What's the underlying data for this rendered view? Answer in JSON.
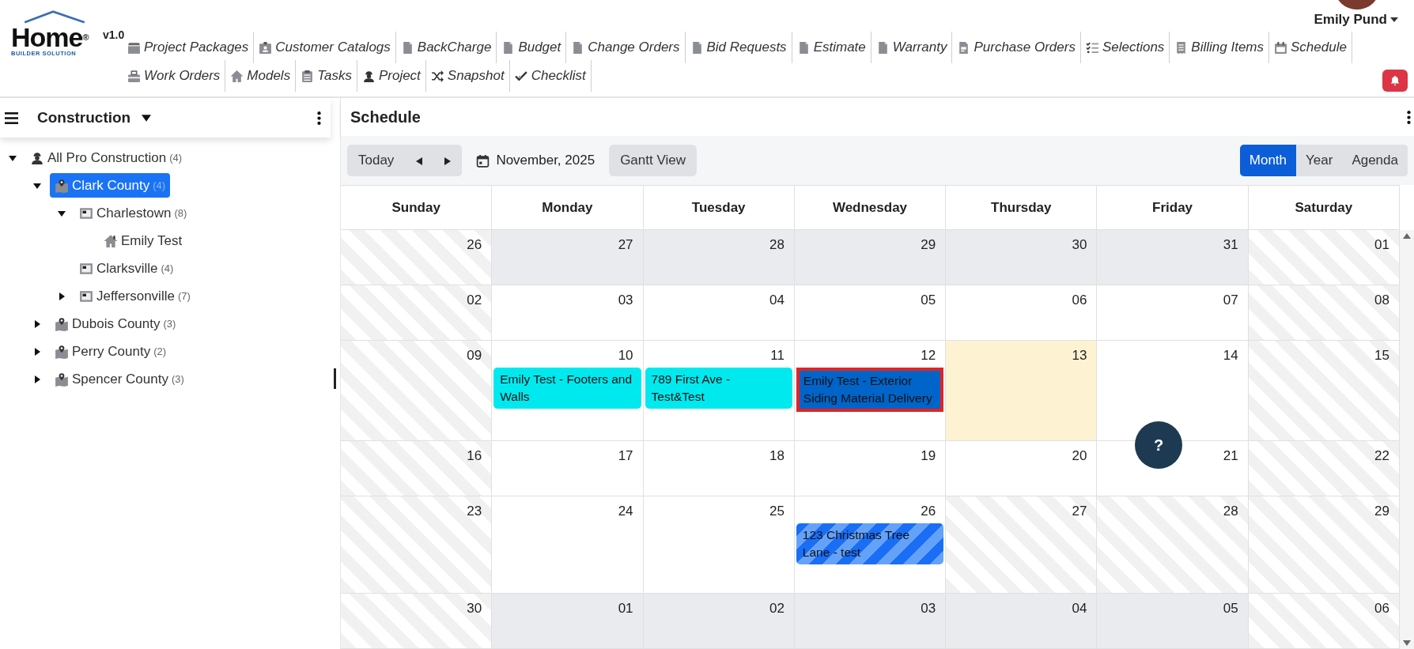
{
  "logo": {
    "name": "Home",
    "mark": "®",
    "tagline": "BUILDER SOLUTION",
    "version": "v1.0"
  },
  "nav_rows": [
    [
      {
        "label": "Project Packages",
        "kind": "package"
      },
      {
        "label": "Customer Catalogs",
        "kind": "badge"
      },
      {
        "label": "BackCharge",
        "kind": "document"
      },
      {
        "label": "Budget",
        "kind": "document"
      },
      {
        "label": "Change Orders",
        "kind": "document"
      },
      {
        "label": "Bid Requests",
        "kind": "document"
      },
      {
        "label": "Estimate",
        "kind": "document"
      },
      {
        "label": "Warranty",
        "kind": "document"
      },
      {
        "label": "Purchase Orders",
        "kind": "invoice"
      },
      {
        "label": "Selections",
        "kind": "checklist"
      },
      {
        "label": "Billing Items",
        "kind": "receipt"
      },
      {
        "label": "Schedule",
        "kind": "calendar"
      }
    ],
    [
      {
        "label": "Work Orders",
        "kind": "toolbox"
      },
      {
        "label": "Models",
        "kind": "house"
      },
      {
        "label": "Tasks",
        "kind": "clipboard"
      },
      {
        "label": "Project",
        "kind": "worker"
      },
      {
        "label": "Snapshot",
        "kind": "shuffle"
      },
      {
        "label": "Checklist",
        "kind": "check"
      }
    ]
  ],
  "user": {
    "name": "Emily Pund"
  },
  "sidebar": {
    "title": "Construction",
    "tree": [
      {
        "label": "All Pro Construction",
        "count": "(4)",
        "kind": "company",
        "expanded": true,
        "selected": false,
        "children": [
          {
            "label": "Clark County",
            "count": "(4)",
            "kind": "county",
            "expanded": true,
            "selected": true,
            "children": [
              {
                "label": "Charlestown",
                "count": "(8)",
                "kind": "city",
                "expanded": true,
                "selected": false,
                "children": [
                  {
                    "label": "Emily Test",
                    "kind": "home",
                    "selected": false
                  }
                ]
              },
              {
                "label": "Clarksville",
                "count": "(4)",
                "kind": "city",
                "selected": false
              },
              {
                "label": "Jeffersonville",
                "count": "(7)",
                "kind": "city",
                "expanded": false,
                "selected": false
              }
            ]
          },
          {
            "label": "Dubois County",
            "count": "(3)",
            "kind": "county",
            "expanded": false,
            "selected": false
          },
          {
            "label": "Perry County",
            "count": "(2)",
            "kind": "county",
            "expanded": false,
            "selected": false
          },
          {
            "label": "Spencer County",
            "count": "(3)",
            "kind": "county",
            "expanded": false,
            "selected": false
          }
        ]
      }
    ]
  },
  "schedule": {
    "title": "Schedule",
    "toolbar": {
      "today": "Today",
      "date": "November, 2025",
      "gantt": "Gantt View",
      "views": [
        {
          "label": "Month",
          "selected": true
        },
        {
          "label": "Year",
          "selected": false
        },
        {
          "label": "Agenda",
          "selected": false
        }
      ]
    },
    "days": [
      "Sunday",
      "Monday",
      "Tuesday",
      "Wednesday",
      "Thursday",
      "Friday",
      "Saturday"
    ],
    "weeks": [
      [
        {
          "date": "26",
          "kind": "striped"
        },
        {
          "date": "27",
          "kind": "outside"
        },
        {
          "date": "28",
          "kind": "outside"
        },
        {
          "date": "29",
          "kind": "outside"
        },
        {
          "date": "30",
          "kind": "outside"
        },
        {
          "date": "31",
          "kind": "outside"
        },
        {
          "date": "01",
          "kind": "striped"
        }
      ],
      [
        {
          "date": "02",
          "kind": "striped"
        },
        {
          "date": "03",
          "kind": "plain"
        },
        {
          "date": "04",
          "kind": "plain"
        },
        {
          "date": "05",
          "kind": "plain"
        },
        {
          "date": "06",
          "kind": "plain"
        },
        {
          "date": "07",
          "kind": "plain"
        },
        {
          "date": "08",
          "kind": "striped"
        }
      ],
      [
        {
          "date": "09",
          "kind": "striped"
        },
        {
          "date": "10",
          "kind": "plain",
          "events": [
            {
              "title": "Emily Test - Footers and Walls",
              "color": "#00e9ee",
              "kind": "solid",
              "selected": false
            }
          ]
        },
        {
          "date": "11",
          "kind": "plain",
          "events": [
            {
              "title": "789 First Ave - Test&Test",
              "color": "#00e9ee",
              "kind": "solid",
              "selected": false
            }
          ]
        },
        {
          "date": "12",
          "kind": "plain",
          "events": [
            {
              "title": "Emily Test - Exterior Siding Material Delivery",
              "color": "#0064c8",
              "kind": "solid",
              "selected": true
            }
          ]
        },
        {
          "date": "13",
          "kind": "today"
        },
        {
          "date": "14",
          "kind": "plain"
        },
        {
          "date": "15",
          "kind": "striped"
        }
      ],
      [
        {
          "date": "16",
          "kind": "striped"
        },
        {
          "date": "17",
          "kind": "plain"
        },
        {
          "date": "18",
          "kind": "plain"
        },
        {
          "date": "19",
          "kind": "plain"
        },
        {
          "date": "20",
          "kind": "plain"
        },
        {
          "date": "21",
          "kind": "plain"
        },
        {
          "date": "22",
          "kind": "striped"
        }
      ],
      [
        {
          "date": "23",
          "kind": "striped"
        },
        {
          "date": "24",
          "kind": "plain"
        },
        {
          "date": "25",
          "kind": "plain"
        },
        {
          "date": "26",
          "kind": "plain",
          "events": [
            {
              "title": "123 Christmas Tree Lane - test",
              "color": "#1a6ef5",
              "kind": "striped",
              "selected": false
            }
          ]
        },
        {
          "date": "27",
          "kind": "striped"
        },
        {
          "date": "28",
          "kind": "striped"
        },
        {
          "date": "29",
          "kind": "striped"
        }
      ],
      [
        {
          "date": "30",
          "kind": "striped"
        },
        {
          "date": "01",
          "kind": "outside"
        },
        {
          "date": "02",
          "kind": "outside"
        },
        {
          "date": "03",
          "kind": "outside"
        },
        {
          "date": "04",
          "kind": "outside"
        },
        {
          "date": "05",
          "kind": "outside"
        },
        {
          "date": "06",
          "kind": "striped"
        }
      ]
    ]
  },
  "help": {
    "label": "?"
  }
}
